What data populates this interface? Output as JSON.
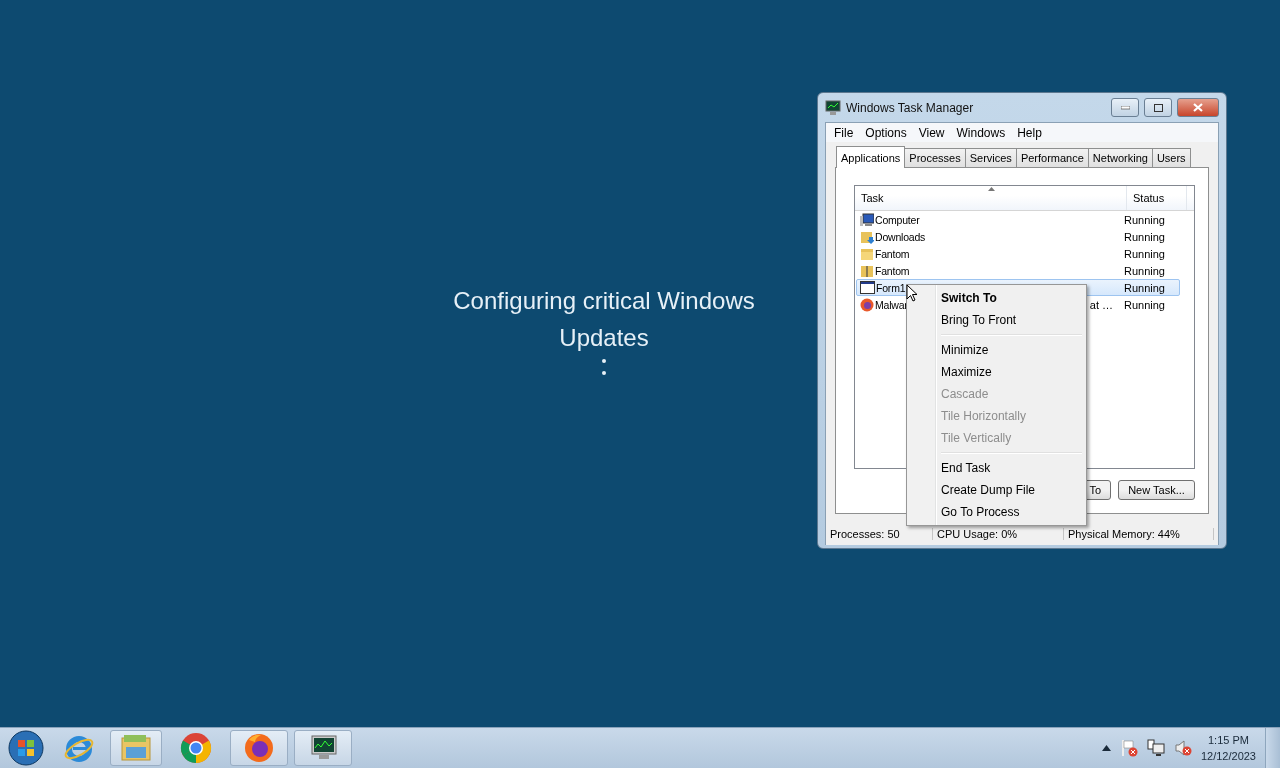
{
  "desktop": {
    "message": [
      "Configuring critical Windows",
      "Updates"
    ]
  },
  "window": {
    "title": "Windows Task Manager",
    "menu": [
      "File",
      "Options",
      "View",
      "Windows",
      "Help"
    ],
    "tabs": [
      {
        "label": "Applications",
        "selected": true
      },
      {
        "label": "Processes",
        "selected": false
      },
      {
        "label": "Services",
        "selected": false
      },
      {
        "label": "Performance",
        "selected": false
      },
      {
        "label": "Networking",
        "selected": false
      },
      {
        "label": "Users",
        "selected": false
      }
    ],
    "table": {
      "columns": [
        "Task",
        "Status"
      ],
      "rows": [
        {
          "kind": "computer",
          "task": "Computer",
          "status": "Running",
          "selected": false
        },
        {
          "kind": "download-folder",
          "task": "Downloads",
          "status": "Running",
          "selected": false
        },
        {
          "kind": "folder",
          "task": "Fantom",
          "status": "Running",
          "selected": false
        },
        {
          "kind": "zip-folder",
          "task": "Fantom",
          "status": "Running",
          "selected": false
        },
        {
          "kind": "window",
          "task": "Form1",
          "status": "Running",
          "selected": true
        },
        {
          "kind": "browser",
          "task": "Malwar",
          "task_tail": "at …",
          "status": "Running",
          "selected": false
        }
      ]
    },
    "buttons": [
      {
        "label": "To",
        "kind": "partial"
      },
      {
        "label": "New Task...",
        "kind": "full"
      }
    ],
    "status_bar": [
      "Processes: 50",
      "CPU Usage: 0%",
      "Physical Memory: 44%"
    ]
  },
  "context_menu": [
    {
      "kind": "item",
      "label": "Switch To",
      "bold": true,
      "disabled": false
    },
    {
      "kind": "item",
      "label": "Bring To Front",
      "bold": false,
      "disabled": false
    },
    {
      "kind": "separator"
    },
    {
      "kind": "item",
      "label": "Minimize",
      "bold": false,
      "disabled": false
    },
    {
      "kind": "item",
      "label": "Maximize",
      "bold": false,
      "disabled": false
    },
    {
      "kind": "item",
      "label": "Cascade",
      "bold": false,
      "disabled": true
    },
    {
      "kind": "item",
      "label": "Tile Horizontally",
      "bold": false,
      "disabled": true
    },
    {
      "kind": "item",
      "label": "Tile Vertically",
      "bold": false,
      "disabled": true
    },
    {
      "kind": "separator"
    },
    {
      "kind": "item",
      "label": "End Task",
      "bold": false,
      "disabled": false
    },
    {
      "kind": "item",
      "label": "Create Dump File",
      "bold": false,
      "disabled": false
    },
    {
      "kind": "item",
      "label": "Go To Process",
      "bold": false,
      "disabled": false
    }
  ],
  "taskbar": {
    "items": [
      {
        "kind": "ie",
        "running": false
      },
      {
        "kind": "explorer",
        "running": true
      },
      {
        "kind": "chrome",
        "running": false
      },
      {
        "kind": "firefox",
        "running": true
      },
      {
        "kind": "taskmgr",
        "running": true
      }
    ],
    "clock": {
      "time": "1:15 PM",
      "date": "12/12/2023"
    }
  }
}
